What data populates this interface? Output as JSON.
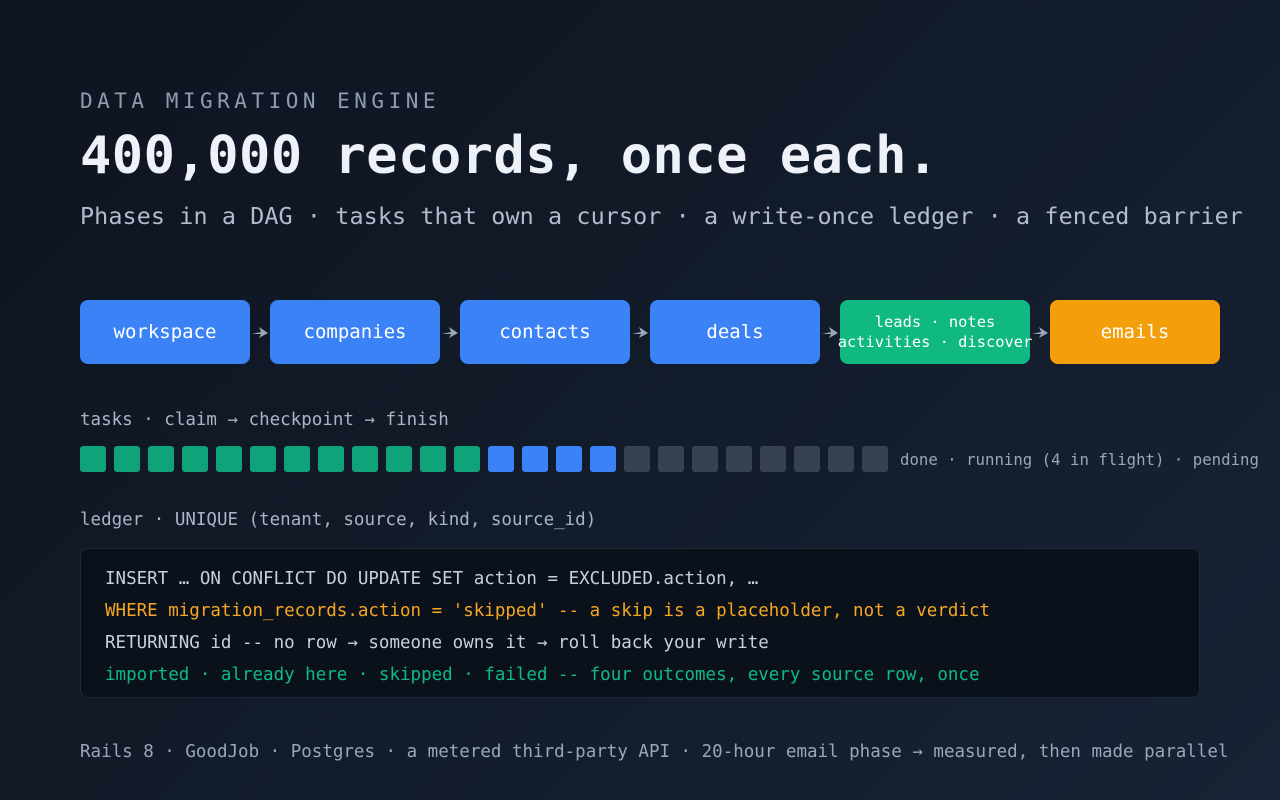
{
  "header": {
    "eyebrow": "DATA MIGRATION ENGINE",
    "title": "400,000 records, once each.",
    "subtitle": "Phases in a DAG · tasks that own a cursor · a write-once ledger · a fenced barrier"
  },
  "dag": {
    "phases": [
      {
        "label": "workspace",
        "color": "#3b82f6"
      },
      {
        "label": "companies",
        "color": "#3b82f6"
      },
      {
        "label": "contacts",
        "color": "#3b82f6"
      },
      {
        "label": "deals",
        "color": "#3b82f6"
      },
      {
        "label_line1": "leads · notes",
        "label_line2": "activities · discover",
        "color": "#10b981"
      },
      {
        "label": "emails",
        "color": "#f59e0b"
      }
    ]
  },
  "tasks": {
    "label": "tasks · claim → checkpoint → finish",
    "done_count": 12,
    "running_count": 4,
    "pending_count": 8,
    "legend": "done · running (4 in flight) · pending",
    "colors": {
      "done": "#10a37a",
      "running": "#3b82f6",
      "pending": "#374151"
    }
  },
  "ledger": {
    "label": "ledger · UNIQUE (tenant, source, kind, source_id)",
    "lines": [
      "INSERT … ON CONFLICT DO UPDATE SET action = EXCLUDED.action, …",
      "WHERE migration_records.action = 'skipped' -- a skip is a placeholder, not a verdict",
      "RETURNING id -- no row → someone owns it → roll back your write",
      "imported · already here · skipped · failed -- four outcomes, every source row, once"
    ]
  },
  "footer": {
    "text": "Rails 8 · GoodJob · Postgres · a metered third-party API · 20-hour email phase → measured, then made parallel"
  }
}
